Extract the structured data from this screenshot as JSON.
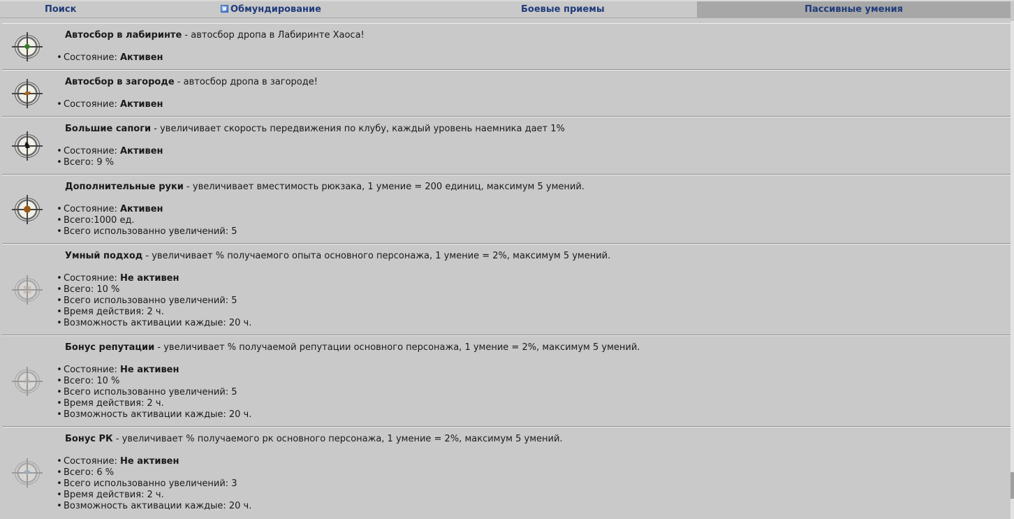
{
  "tabs": {
    "search": "Поиск",
    "equipment": "Обмундирование",
    "combat": "Боевые приемы",
    "passive": "Пассивные умения"
  },
  "labels": {
    "state": "Состояние: ",
    "total": "Всего: ",
    "total_compact": "Всего:",
    "used": "Всего использованно увеличений: ",
    "duration": "Время действия: ",
    "cooldown": "Возможность активации каждые: "
  },
  "skills": [
    {
      "name": "Автосбор в лабиринте",
      "desc": " - автосбор дропа в Лабиринте Хаоса!",
      "icon": "sack-icon",
      "state": "Активен"
    },
    {
      "name": "Автосбор в загороде",
      "desc": " - автосбор дропа в загороде!",
      "icon": "scroll-icon",
      "state": "Активен"
    },
    {
      "name": "Большие сапоги",
      "desc": " - увеличивает скорость передвижения по клубу, каждый уровень наемника дает 1%",
      "icon": "runner-icon",
      "state": "Активен",
      "total": "9 %"
    },
    {
      "name": "Дополнительные руки",
      "desc": " - увеличивает вместимость рюкзака, 1 умение = 200 единиц, максимум 5 умений.",
      "icon": "bag-icon",
      "state": "Активен",
      "total": "1000 ед.",
      "used": "5"
    },
    {
      "name": "Умный подход",
      "desc": " - увеличивает % получаемого опыта основного персонажа, 1 умение = 2%, максимум 5 умений.",
      "icon": "book-icon",
      "state": "Не активен",
      "total": "10 %",
      "used": "5",
      "duration": "2 ч.",
      "cooldown": "20 ч."
    },
    {
      "name": "Бонус репутации",
      "desc": " - увеличивает % получаемой репутации основного персонажа, 1 умение = 2%, максимум 5 умений.",
      "icon": "skull-icon",
      "state": "Не активен",
      "total": "10 %",
      "used": "5",
      "duration": "2 ч.",
      "cooldown": "20 ч."
    },
    {
      "name": "Бонус РК",
      "desc": " - увеличивает % получаемого рк основного персонажа, 1 умение = 2%, максимум 5 умений.",
      "icon": "crystal-icon",
      "state": "Не активен",
      "total": "6 %",
      "used": "3",
      "duration": "2 ч.",
      "cooldown": "20 ч."
    }
  ]
}
